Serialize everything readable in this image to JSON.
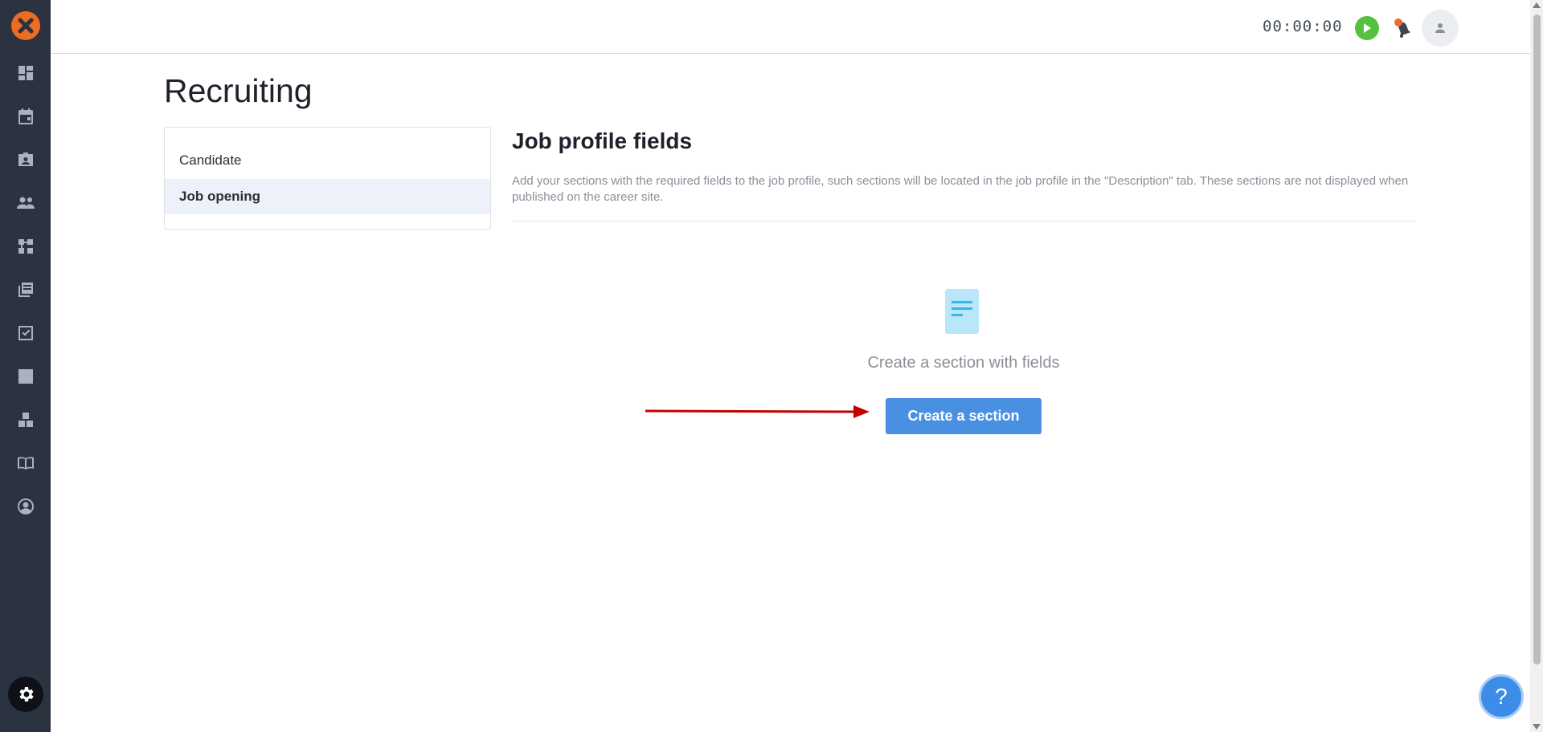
{
  "topbar": {
    "timer": "00:00:00"
  },
  "sidebar": {
    "items": [
      {
        "icon": "dashboard-icon"
      },
      {
        "icon": "calendar-icon"
      },
      {
        "icon": "contact-card-icon"
      },
      {
        "icon": "people-icon"
      },
      {
        "icon": "workflow-icon"
      },
      {
        "icon": "library-icon"
      },
      {
        "icon": "tasks-check-icon"
      },
      {
        "icon": "analytics-chart-icon"
      },
      {
        "icon": "blocks-icon"
      },
      {
        "icon": "book-icon"
      },
      {
        "icon": "account-circle-icon"
      }
    ],
    "settings_icon": "gear-icon"
  },
  "page": {
    "title": "Recruiting"
  },
  "menu": {
    "items": [
      {
        "label": "Candidate"
      },
      {
        "label": "Job opening"
      }
    ],
    "active": "Job opening"
  },
  "main": {
    "title": "Job profile fields",
    "description": "Add your sections with the required fields to the job profile, such sections will be located in the job profile in the \"Description\" tab. These sections are not displayed when published on the career site.",
    "empty_text": "Create a section with fields",
    "create_button": "Create a section"
  },
  "help": {
    "label": "?"
  },
  "colors": {
    "sidebar_bg": "#2b3340",
    "accent": "#4a90e2",
    "logo": "#f26b22",
    "play": "#56c13f",
    "annotation_arrow": "#c40000"
  }
}
